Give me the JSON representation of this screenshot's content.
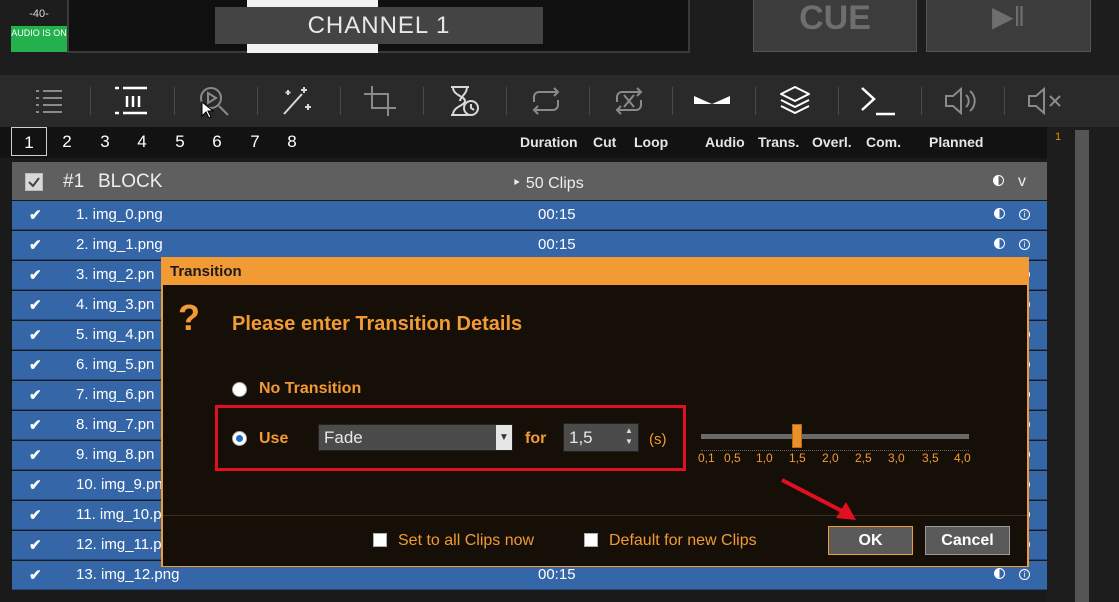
{
  "header": {
    "audio_level": "-40-",
    "audio_status": "AUDIO IS ON",
    "channel": "CHANNEL 1",
    "cue_label": "CUE",
    "play_pause_label": "▶‖"
  },
  "toolbar": {
    "icons": [
      "playlist-icon",
      "block-icon",
      "search-play-icon",
      "magic-wand-icon",
      "crop-icon",
      "timer-icon",
      "loop-icon",
      "no-loop-icon",
      "transition-icon",
      "layers-icon",
      "command-icon",
      "volume-icon",
      "mute-icon"
    ]
  },
  "list": {
    "tabs": [
      "1",
      "2",
      "3",
      "4",
      "5",
      "6",
      "7",
      "8"
    ],
    "active_tab": "1",
    "columns": [
      "Duration",
      "Cut",
      "Loop",
      "Audio",
      "Trans.",
      "Overl.",
      "Com.",
      "Planned"
    ],
    "block": {
      "index": "#1",
      "name": "BLOCK",
      "clip_count": "‣ 50 Clips",
      "expand": "v"
    },
    "clips": [
      {
        "label": "1. img_0.png",
        "duration": "00:15"
      },
      {
        "label": "2. img_1.png",
        "duration": "00:15"
      },
      {
        "label": "3. img_2.pn",
        "duration": ""
      },
      {
        "label": "4. img_3.pn",
        "duration": ""
      },
      {
        "label": "5. img_4.pn",
        "duration": ""
      },
      {
        "label": "6. img_5.pn",
        "duration": ""
      },
      {
        "label": "7. img_6.pn",
        "duration": ""
      },
      {
        "label": "8. img_7.pn",
        "duration": ""
      },
      {
        "label": "9. img_8.pn",
        "duration": ""
      },
      {
        "label": "10. img_9.pn",
        "duration": ""
      },
      {
        "label": "11. img_10.p",
        "duration": ""
      },
      {
        "label": "12. img_11.p",
        "duration": ""
      },
      {
        "label": "13. img_12.png",
        "duration": "00:15"
      }
    ],
    "gutter_number": "1"
  },
  "dialog": {
    "title": "Transition",
    "question_mark": "?",
    "heading": "Please enter Transition Details",
    "no_transition_label": "No Transition",
    "use_label": "Use",
    "selected_option": "use",
    "transition_type": "Fade",
    "for_label": "for",
    "seconds_value": "1,5",
    "unit_label": "(s)",
    "slider_value": 1.5,
    "slider_labels": [
      "0,1",
      "0,5",
      "1,0",
      "1,5",
      "2,0",
      "2,5",
      "3,0",
      "3,5",
      "4,0"
    ],
    "set_all_label": "Set to all Clips now",
    "default_new_label": "Default for new Clips",
    "ok_label": "OK",
    "cancel_label": "Cancel"
  },
  "colors": {
    "accent_orange": "#f29a34",
    "row_blue": "#3566a8",
    "highlight_red": "#e01020"
  }
}
